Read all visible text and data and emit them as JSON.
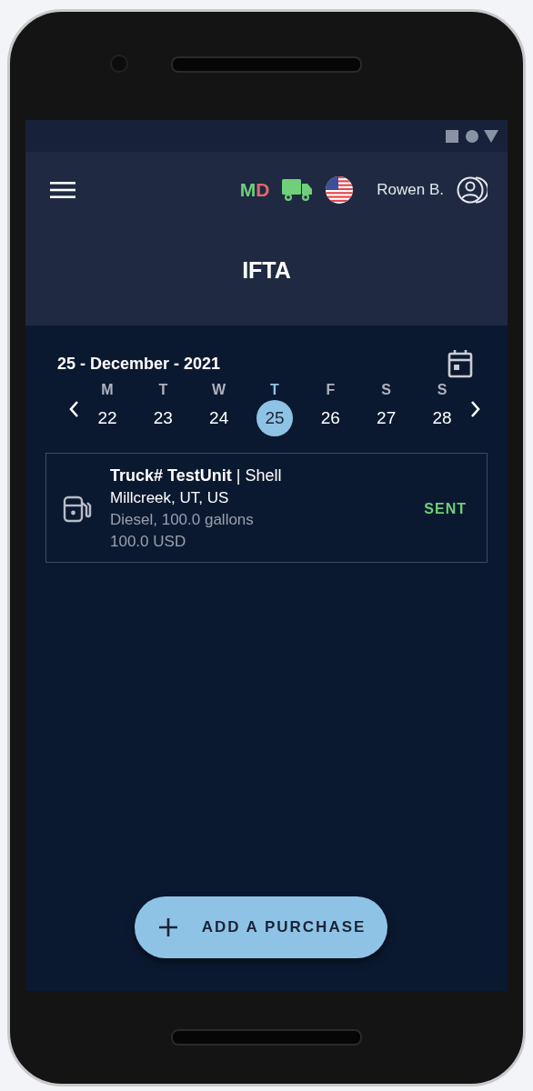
{
  "header": {
    "status_letters": [
      {
        "text": "M",
        "color": "#6fcf7a"
      },
      {
        "text": "D",
        "color": "#e0676a"
      }
    ],
    "user_name": "Rowen B.",
    "title": "IFTA"
  },
  "date_bar": {
    "date": "25 - December - 2021"
  },
  "week": [
    {
      "weekday": "M",
      "day": "22",
      "selected": false
    },
    {
      "weekday": "T",
      "day": "23",
      "selected": false
    },
    {
      "weekday": "W",
      "day": "24",
      "selected": false
    },
    {
      "weekday": "T",
      "day": "25",
      "selected": true
    },
    {
      "weekday": "F",
      "day": "26",
      "selected": false
    },
    {
      "weekday": "S",
      "day": "27",
      "selected": false
    },
    {
      "weekday": "S",
      "day": "28",
      "selected": false
    }
  ],
  "purchases": [
    {
      "title": "**Truck# TestUnit** | Shell",
      "location": "Millcreek, UT, US",
      "fuel": "Diesel, 100.0 gallons",
      "amount": "100.0 USD",
      "status": "SENT"
    }
  ],
  "fab": {
    "label": "ADD A PURCHASE"
  }
}
